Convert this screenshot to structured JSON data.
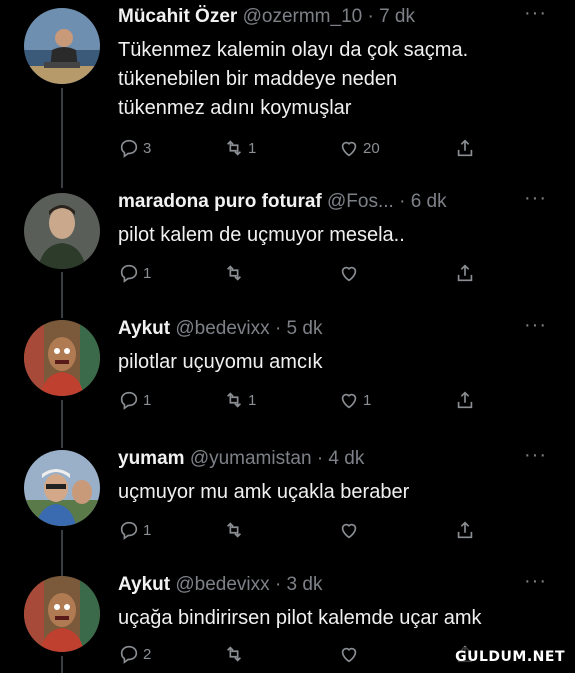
{
  "tweets": [
    {
      "name": "Mücahit Özer",
      "handle": "@ozermm_10",
      "time": "· 7 dk",
      "text": "Tükenmez kalemin olayı da çok saçma.\ntükenebilen bir maddeye neden\ntükenmez adını koymuşlar",
      "replies": "3",
      "retweets": "1",
      "likes": "20"
    },
    {
      "name": "maradona puro foturaf",
      "handle": "@Fos...",
      "time": "· 6 dk",
      "text": "pilot kalem de uçmuyor mesela..",
      "replies": "1",
      "retweets": "",
      "likes": ""
    },
    {
      "name": "Aykut",
      "handle": "@bedevixx",
      "time": "· 5 dk",
      "text": "pilotlar uçuyomu amcık",
      "replies": "1",
      "retweets": "1",
      "likes": "1"
    },
    {
      "name": "yumam",
      "handle": "@yumamistan",
      "time": "· 4 dk",
      "text": "uçmuyor mu amk uçakla beraber",
      "replies": "1",
      "retweets": "",
      "likes": ""
    },
    {
      "name": "Aykut",
      "handle": "@bedevixx",
      "time": "· 3 dk",
      "text": "uçağa bindirirsen pilot kalemde uçar amk",
      "replies": "2",
      "retweets": "",
      "likes": ""
    }
  ],
  "more_label": "···",
  "watermark": "GULDUM.NET",
  "icons": [
    "reply-icon",
    "retweet-icon",
    "like-icon",
    "share-icon",
    "more-icon"
  ],
  "colors": {
    "background": "#000000",
    "text": "#e7e9ea",
    "muted": "#7d8187"
  }
}
